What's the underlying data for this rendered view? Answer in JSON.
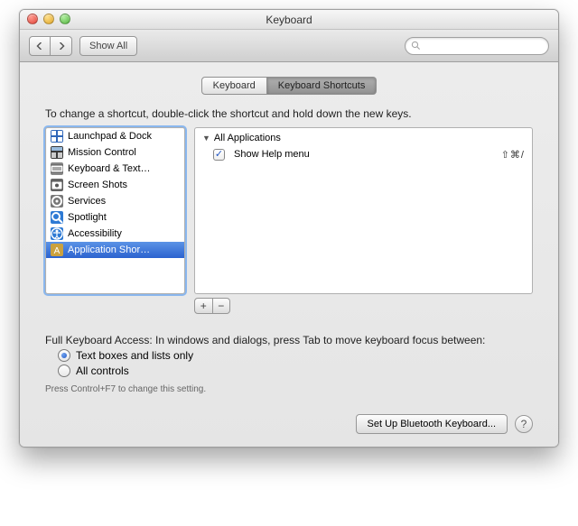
{
  "window": {
    "title": "Keyboard"
  },
  "toolbar": {
    "show_all": "Show All",
    "search_placeholder": ""
  },
  "tabs": {
    "keyboard": "Keyboard",
    "shortcuts": "Keyboard Shortcuts"
  },
  "instruction": "To change a shortcut, double-click the shortcut and hold down the new keys.",
  "categories": [
    {
      "label": "Launchpad & Dock",
      "icon": "launchpad",
      "bg": "#2f66b8"
    },
    {
      "label": "Mission Control",
      "icon": "mission",
      "bg": "#3a3a3a"
    },
    {
      "label": "Keyboard & Text…",
      "icon": "keyboard",
      "bg": "#888"
    },
    {
      "label": "Screen Shots",
      "icon": "screenshot",
      "bg": "#666"
    },
    {
      "label": "Services",
      "icon": "services",
      "bg": "#777"
    },
    {
      "label": "Spotlight",
      "icon": "spotlight",
      "bg": "#2e7ad4"
    },
    {
      "label": "Accessibility",
      "icon": "accessibility",
      "bg": "#2e7ad4"
    },
    {
      "label": "Application Shor…",
      "icon": "appshort",
      "bg": "#caa13f",
      "selected": true
    }
  ],
  "shortcuts": {
    "group": "All Applications",
    "items": [
      {
        "label": "Show Help menu",
        "checked": true,
        "keys": "⇧⌘/"
      }
    ]
  },
  "buttons": {
    "plus": "+",
    "minus": "−"
  },
  "fka": {
    "label": "Full Keyboard Access: In windows and dialogs, press Tab to move keyboard focus between:",
    "opt1": "Text boxes and lists only",
    "opt2": "All controls",
    "hint": "Press Control+F7 to change this setting."
  },
  "footer": {
    "bluetooth": "Set Up Bluetooth Keyboard...",
    "help": "?"
  }
}
